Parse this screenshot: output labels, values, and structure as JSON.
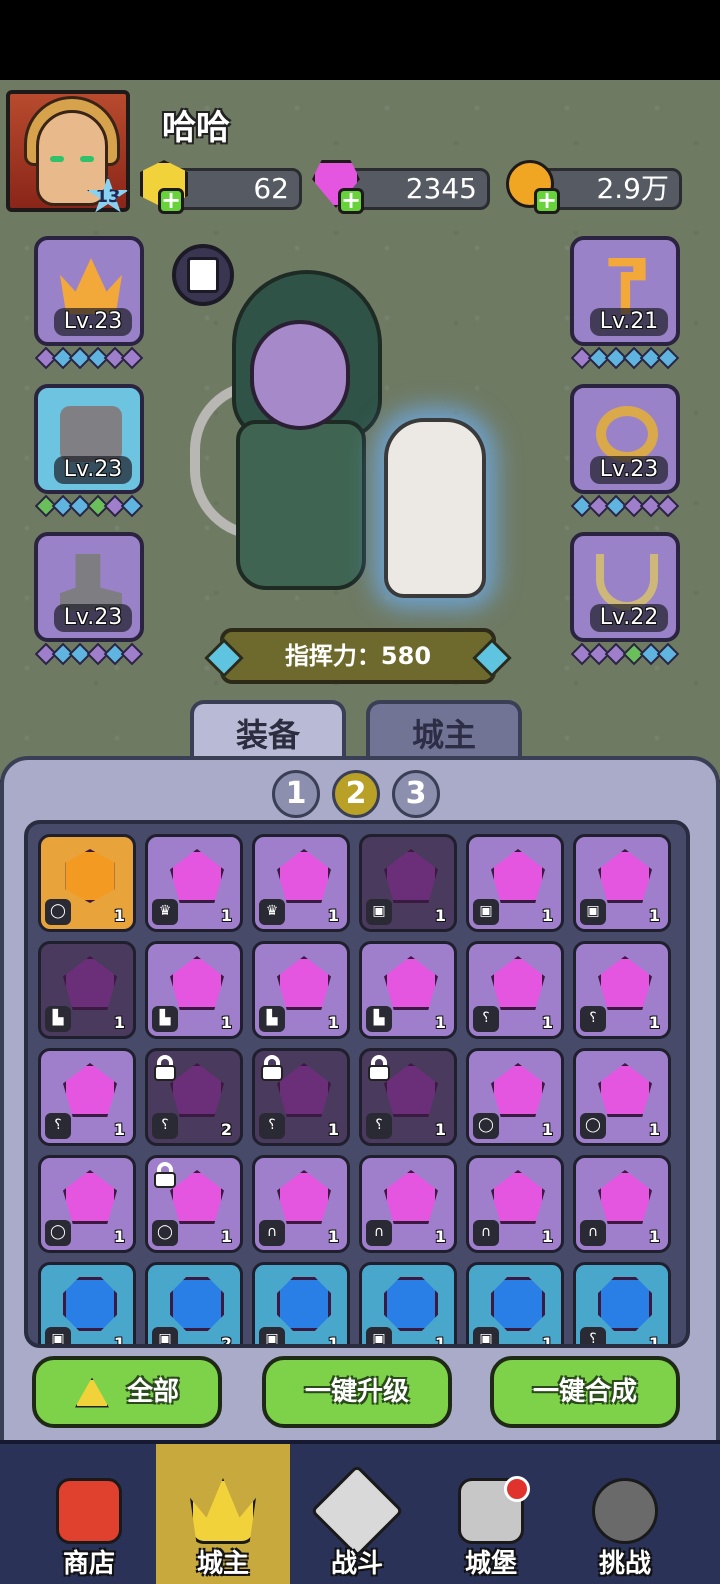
{
  "player": {
    "name": "哈哈",
    "level": "13"
  },
  "currencies": [
    {
      "name": "gold-gem",
      "value": "62",
      "color": "#f2d23a"
    },
    {
      "name": "pink-crystal",
      "value": "2345",
      "color": "#e456e0"
    },
    {
      "name": "coin",
      "value": "2.9万",
      "color": "#f0a622"
    }
  ],
  "equipment_left": [
    {
      "icon": "crown-icon",
      "level": "Lv.23"
    },
    {
      "icon": "armor-icon",
      "level": "Lv.23"
    },
    {
      "icon": "boot-icon",
      "level": "Lv.23"
    }
  ],
  "equipment_right": [
    {
      "icon": "staff-icon",
      "level": "Lv.21"
    },
    {
      "icon": "ring-icon",
      "level": "Lv.23"
    },
    {
      "icon": "amulet-icon",
      "level": "Lv.22"
    }
  ],
  "command_power": "指挥力：580",
  "tabs": {
    "equipment": "装备",
    "lord": "城主"
  },
  "pages": [
    "1",
    "2",
    "3"
  ],
  "inventory": [
    [
      {
        "type": "gold",
        "tag": "ring",
        "count": "1"
      },
      {
        "type": "purple",
        "tag": "crown",
        "count": "1"
      },
      {
        "type": "purple",
        "tag": "crown",
        "count": "1"
      },
      {
        "type": "dark",
        "tag": "armor",
        "count": "1"
      },
      {
        "type": "purple",
        "tag": "armor",
        "count": "1"
      },
      {
        "type": "purple",
        "tag": "armor",
        "count": "1"
      }
    ],
    [
      {
        "type": "dark",
        "tag": "boot",
        "count": "1"
      },
      {
        "type": "purple",
        "tag": "boot",
        "count": "1"
      },
      {
        "type": "purple",
        "tag": "boot",
        "count": "1"
      },
      {
        "type": "purple",
        "tag": "boot",
        "count": "1"
      },
      {
        "type": "purple",
        "tag": "staff",
        "count": "1"
      },
      {
        "type": "purple",
        "tag": "staff",
        "count": "1"
      }
    ],
    [
      {
        "type": "purple",
        "tag": "staff",
        "count": "1"
      },
      {
        "type": "dark",
        "tag": "staff",
        "count": "2",
        "locked": true
      },
      {
        "type": "dark",
        "tag": "staff",
        "count": "1",
        "locked": true
      },
      {
        "type": "dark",
        "tag": "staff",
        "count": "1",
        "locked": true
      },
      {
        "type": "purple",
        "tag": "ring",
        "count": "1"
      },
      {
        "type": "purple",
        "tag": "ring",
        "count": "1"
      }
    ],
    [
      {
        "type": "purple",
        "tag": "ring",
        "count": "1"
      },
      {
        "type": "purple",
        "tag": "ring",
        "count": "1",
        "locked": true
      },
      {
        "type": "purple",
        "tag": "amulet",
        "count": "1"
      },
      {
        "type": "purple",
        "tag": "amulet",
        "count": "1"
      },
      {
        "type": "purple",
        "tag": "amulet",
        "count": "1"
      },
      {
        "type": "purple",
        "tag": "amulet",
        "count": "1"
      }
    ],
    [
      {
        "type": "blue",
        "tag": "armor",
        "count": "1"
      },
      {
        "type": "blue",
        "tag": "armor",
        "count": "2"
      },
      {
        "type": "blue",
        "tag": "armor",
        "count": "1"
      },
      {
        "type": "blue",
        "tag": "armor",
        "count": "1"
      },
      {
        "type": "blue",
        "tag": "armor",
        "count": "1"
      },
      {
        "type": "blue",
        "tag": "staff",
        "count": "1"
      }
    ]
  ],
  "actions": {
    "all": "全部",
    "upgrade": "一键升级",
    "merge": "一键合成"
  },
  "nav": [
    {
      "label": "商店",
      "icon": "shop-icon",
      "color": "#e0402e"
    },
    {
      "label": "城主",
      "icon": "crown-icon",
      "color": "#f2d23a"
    },
    {
      "label": "战斗",
      "icon": "swords-icon",
      "color": "#d9d9d9"
    },
    {
      "label": "城堡",
      "icon": "castle-icon",
      "color": "#c7c7c7"
    },
    {
      "label": "挑战",
      "icon": "demon-icon",
      "color": "#6a6a6a"
    }
  ]
}
